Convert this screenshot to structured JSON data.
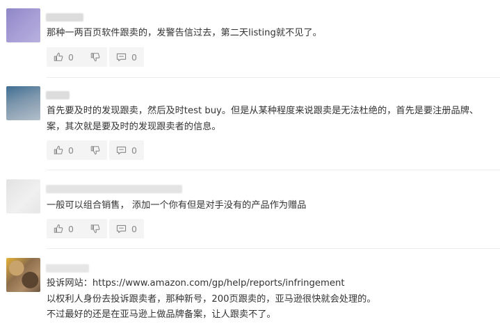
{
  "comments": [
    {
      "text_lines": [
        "那种一两百页软件跟卖的，发警告信过去，第二天listing就不见了。"
      ],
      "likes": "0",
      "comments": "0",
      "avatar_colors": [
        "#8f86c7",
        "#b7b1de",
        "#a69dd6"
      ]
    },
    {
      "text_lines": [
        "首先要及时的发现跟卖，然后及时test buy。但是从某种程度来说跟卖是无法杜绝的，首先是要注册品牌、",
        "案，其次就是要及时的发现跟卖者的信息。"
      ],
      "likes": "0",
      "comments": "0",
      "avatar_colors": [
        "#4d7a9e",
        "#97a9b9",
        "#6e8aa5"
      ]
    },
    {
      "text_lines": [
        "一般可以组合销售， 添加一个你有但是对手没有的产品作为赠品"
      ],
      "likes": "0",
      "comments": "0",
      "avatar_colors": [
        "#e7e7e7",
        "#efefef",
        "#dedede"
      ]
    },
    {
      "text_lines": [
        "投诉网站：https://www.amazon.com/gp/help/reports/infringement",
        "以权利人身份去投诉跟卖者，那种新号，200页跟卖的，亚马逊很快就会处理的。",
        "不过最好的还是在亚马逊上做品牌备案，让人跟卖不了。"
      ],
      "avatar_colors": [
        "#8d6e4b",
        "#c9a36c",
        "#5a4430"
      ]
    }
  ]
}
